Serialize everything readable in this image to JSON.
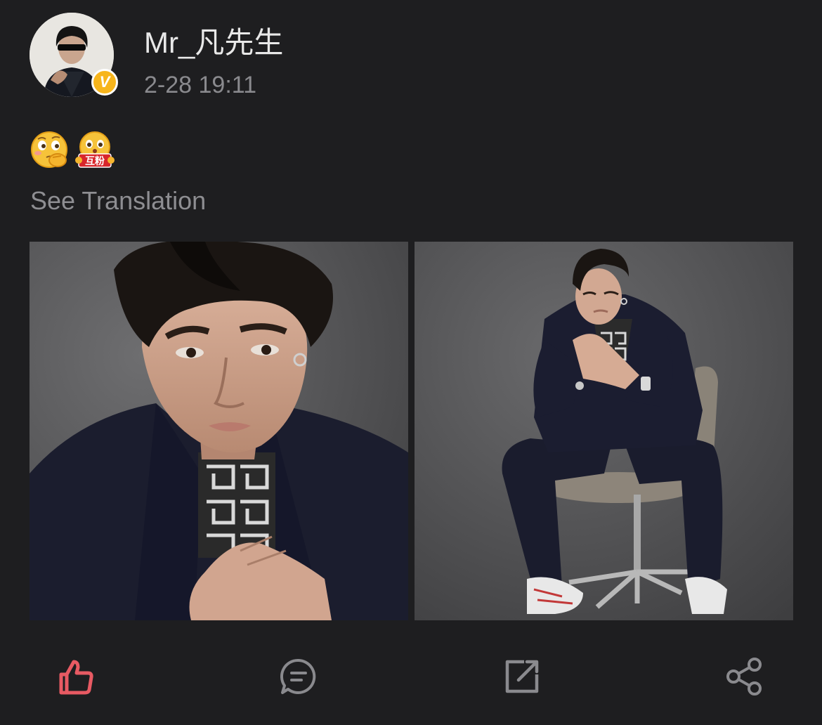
{
  "post": {
    "username": "Mr_凡先生",
    "timestamp": "2-28 19:11",
    "verified_badge": "V",
    "emoji_badge_text": "互粉",
    "see_translation": "See Translation"
  },
  "emojis": [
    "thinking-emoji",
    "mutual-follow-emoji"
  ],
  "actions": [
    "like",
    "comment",
    "repost",
    "share"
  ],
  "colors": {
    "background": "#1e1e20",
    "username": "#e8e8e8",
    "secondary_text": "#8a8a8e",
    "like_active": "#e85a63",
    "icon_gray": "#8a8a8e",
    "verified": "#f7b51c"
  }
}
